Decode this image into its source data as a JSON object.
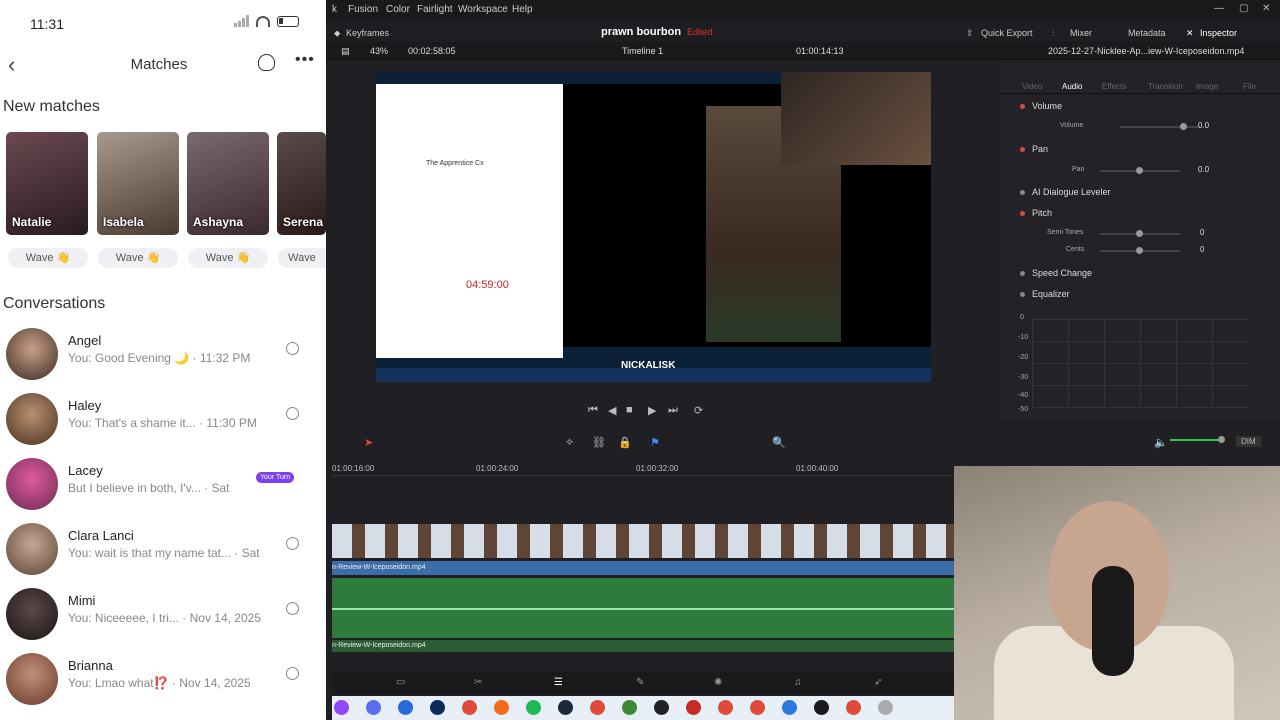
{
  "phone": {
    "time": "11:31",
    "title": "Matches",
    "new_matches_heading": "New matches",
    "conversations_heading": "Conversations",
    "matches": [
      {
        "label": "Natalie",
        "wave": "Wave 👋"
      },
      {
        "label": "Isabela",
        "wave": "Wave 👋"
      },
      {
        "label": "Ashayna",
        "wave": "Wave 👋"
      },
      {
        "label": "Serena",
        "wave": "Wave"
      }
    ],
    "conversations": [
      {
        "name": "Angel",
        "message": "You: Good Evening 🌙 · 11:32 PM"
      },
      {
        "name": "Haley",
        "message": "You: That's a shame it... · 11:30 PM"
      },
      {
        "name": "Lacey",
        "message": "But I believe in both, I'v... · Sat",
        "badge": "Your Turn"
      },
      {
        "name": "Clara Lanci",
        "message": "You: wait is that my name tat... · Sat"
      },
      {
        "name": "Mimi",
        "message": "You: Niceeeee, I tri... · Nov 14, 2025"
      },
      {
        "name": "Brianna",
        "message": "You: Lmao what⁉️ · Nov 14, 2025"
      }
    ]
  },
  "resolve": {
    "menu": [
      "Fusion",
      "Color",
      "Fairlight",
      "Workspace",
      "Help"
    ],
    "keyframes": "Keyframes",
    "project_title": "prawn bourbon",
    "edited": "Edited",
    "top_right": [
      "Quick Export",
      "Mixer",
      "Metadata",
      "Inspector"
    ],
    "zoom": "43%",
    "timecode_left": "00:02:58:05",
    "timeline_name": "Timeline 1",
    "timecode_right": "01:00:14:13",
    "clip_name": "2025-12-27-Nicklee-Ap...iew-W-Iceposeidon.mp4",
    "viewer_timer": "04:59:00",
    "doc_title": "The Apprentice Cx",
    "overlay_name": "NICKALISK",
    "ruler": [
      "01:00:16:00",
      "01:00:24:00",
      "01:00:32:00",
      "01:00:40:00"
    ],
    "video_clip_label": "n-Review-W-Iceposeidon.mp4",
    "audio_clip_label": "n-Review-W-Iceposeidon.mp4",
    "inspector_tabs": [
      "Video",
      "Audio",
      "Effects",
      "Transition",
      "Image",
      "File"
    ],
    "inspector": {
      "volume_section": "Volume",
      "volume_label": "Volume",
      "volume_value": "0.0",
      "pan_section": "Pan",
      "pan_label": "Pan",
      "pan_value": "0.0",
      "dialogue": "AI Dialogue Leveler",
      "pitch_section": "Pitch",
      "semitones_label": "Semi Tones",
      "semitones_value": "0",
      "cents_label": "Cents",
      "cents_value": "0",
      "speed_change": "Speed Change",
      "equalizer": "Equalizer",
      "eq_ticks": [
        "0",
        "-10",
        "-20",
        "-30",
        "-40",
        "-50"
      ]
    },
    "dim": "DIM"
  },
  "colors": {
    "accent_red": "#e0463a",
    "audio_green": "#2f7a3d",
    "video_blue": "#3b6ea8",
    "badge_purple": "#7a42f4"
  }
}
